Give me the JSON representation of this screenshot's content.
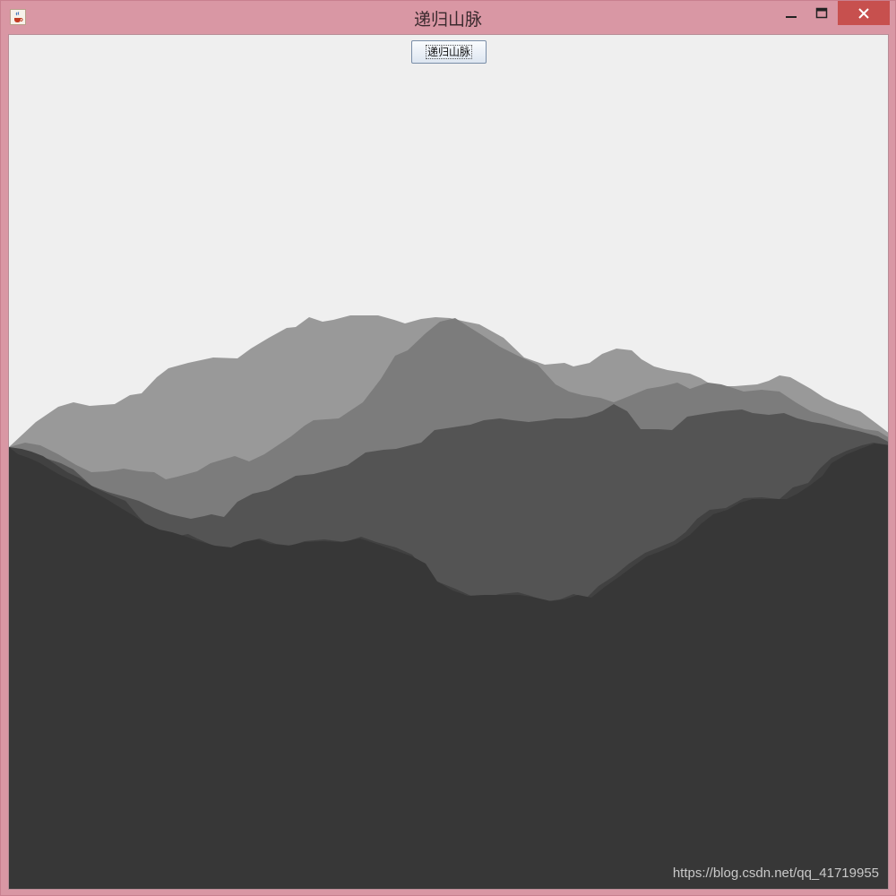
{
  "window": {
    "title": "递归山脉",
    "icon": "java-cup-icon",
    "controls": {
      "minimize_icon": "minimize-icon",
      "maximize_icon": "maximize-icon",
      "close_icon": "close-icon"
    }
  },
  "toolbar": {
    "button_label": "递归山脉"
  },
  "canvas": {
    "background": "#efefef",
    "layer_colors": [
      "#999999",
      "#7c7c7c",
      "#545454",
      "#414141",
      "#373737"
    ]
  },
  "watermark": "https://blog.csdn.net/qq_41719955"
}
